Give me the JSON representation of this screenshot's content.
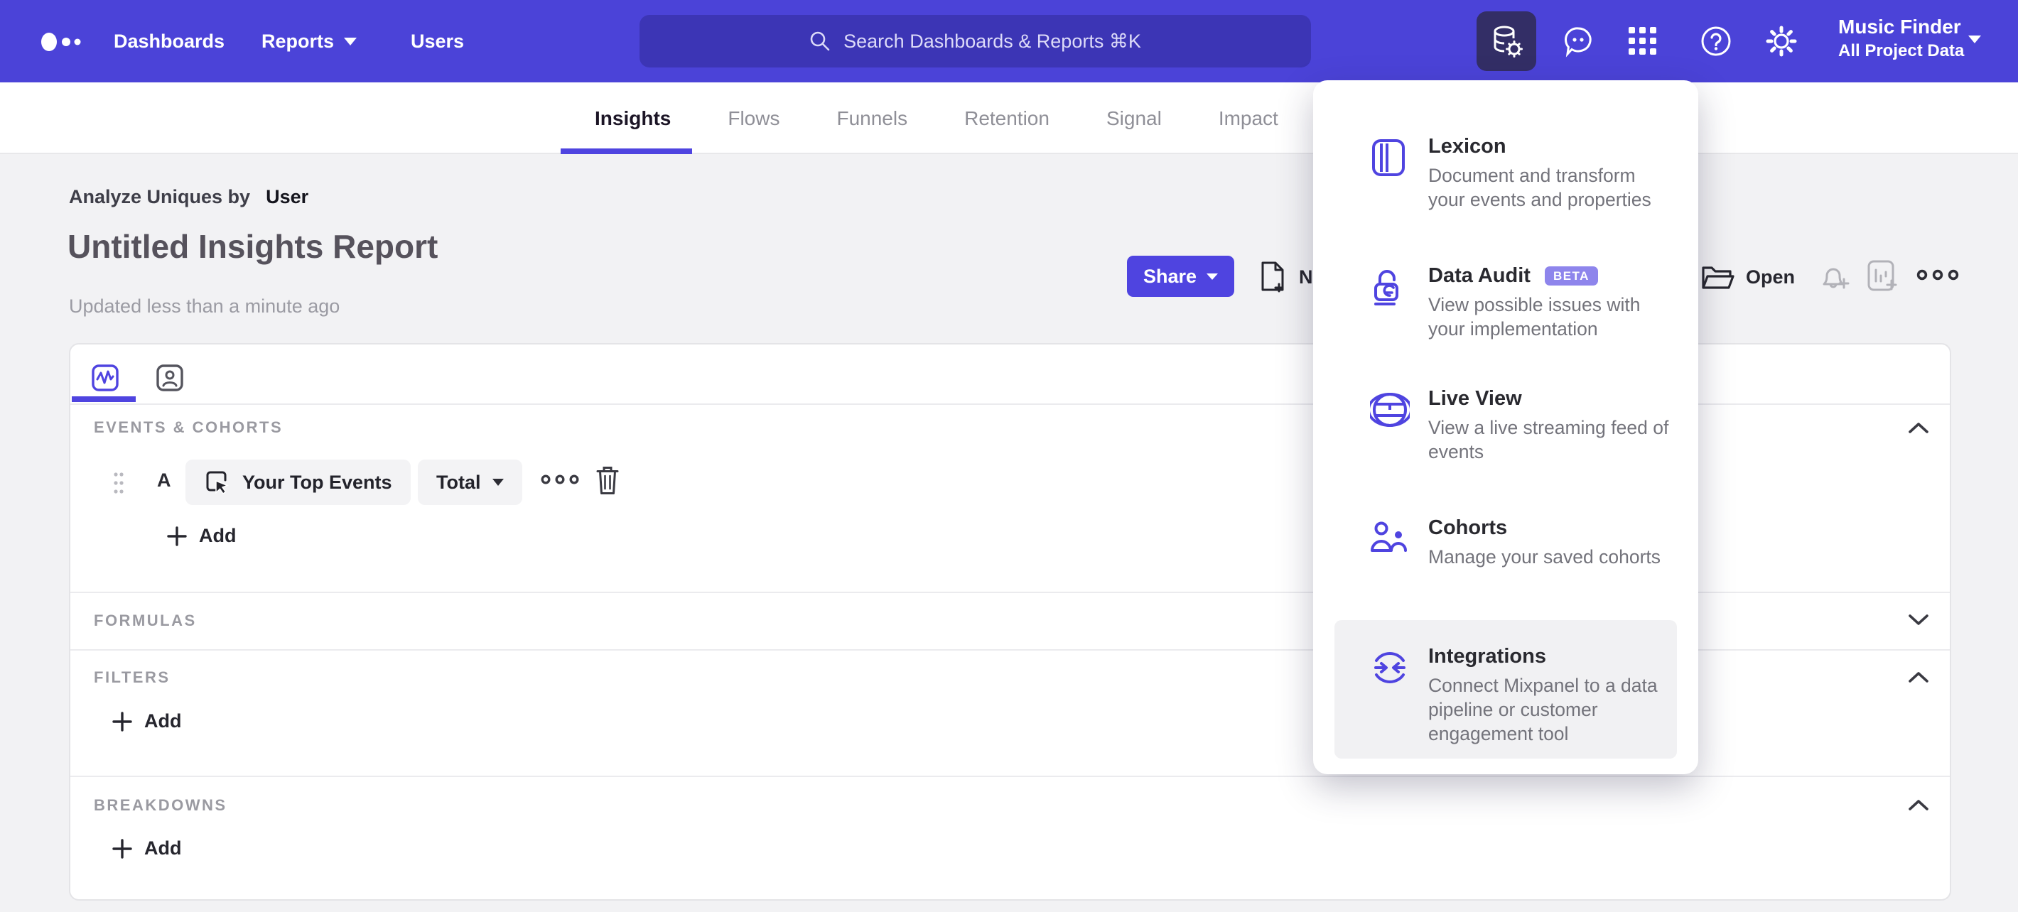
{
  "colors": {
    "accent": "#4f44e0",
    "nav_background": "#4b43d8",
    "nav_active_tile": "#332e66",
    "beta_badge": "#8e85ec",
    "page_background": "#f2f2f4"
  },
  "nav": {
    "links": {
      "dashboards": "Dashboards",
      "reports": "Reports",
      "users": "Users"
    },
    "search_placeholder": "Search Dashboards & Reports ⌘K",
    "project_name": "Music Finder",
    "project_scope": "All Project Data",
    "icons": [
      "data-management-icon",
      "feedback-bubble-icon",
      "apps-grid-icon",
      "help-icon",
      "settings-gear-icon"
    ]
  },
  "tabs": [
    {
      "label": "Insights",
      "active": true
    },
    {
      "label": "Flows"
    },
    {
      "label": "Funnels"
    },
    {
      "label": "Retention"
    },
    {
      "label": "Signal"
    },
    {
      "label": "Impact"
    }
  ],
  "header": {
    "analyze_prefix": "Analyze Uniques by",
    "analyze_entity": "User",
    "title": "Untitled Insights Report",
    "updated": "Updated less than a minute ago",
    "share": "Share",
    "new": "New",
    "open": "Open"
  },
  "builder": {
    "events": {
      "label": "EVENTS & COHORTS",
      "row_letter": "A",
      "event_name": "Your Top Events",
      "metric": "Total",
      "add": "Add"
    },
    "formulas": {
      "label": "FORMULAS"
    },
    "filters": {
      "label": "FILTERS",
      "add": "Add"
    },
    "breakdowns": {
      "label": "BREAKDOWNS",
      "add": "Add"
    }
  },
  "menu": {
    "items": [
      {
        "title": "Lexicon",
        "desc": "Document and transform your events and properties"
      },
      {
        "title": "Data Audit",
        "badge": "BETA",
        "desc": "View possible issues with your implementation"
      },
      {
        "title": "Live View",
        "desc": "View a live streaming feed of events"
      },
      {
        "title": "Cohorts",
        "desc": "Manage your saved cohorts"
      },
      {
        "title": "Integrations",
        "desc": "Connect Mixpanel to a data pipeline or customer engagement tool"
      }
    ]
  }
}
